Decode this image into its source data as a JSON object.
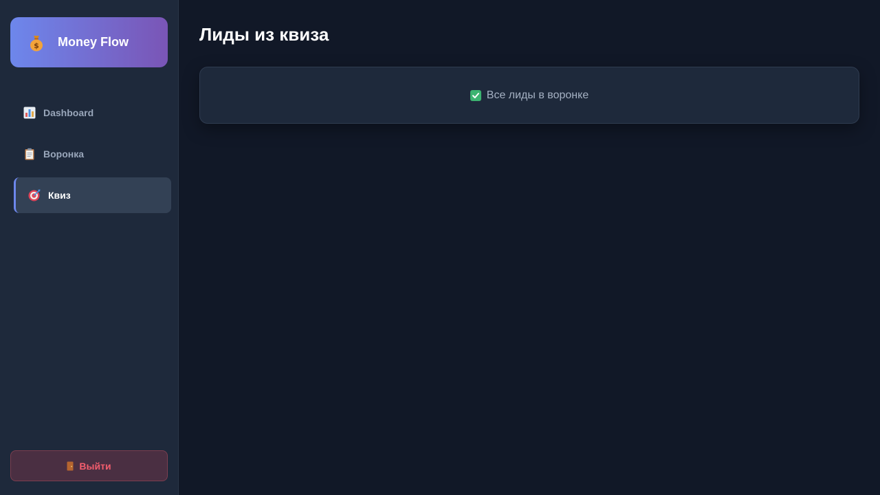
{
  "brand": {
    "title": "Money Flow",
    "icon": "money-bag-icon"
  },
  "sidebar": {
    "items": [
      {
        "label": "Dashboard",
        "icon": "bar-chart-icon",
        "active": false
      },
      {
        "label": "Воронка",
        "icon": "clipboard-icon",
        "active": false
      },
      {
        "label": "Квиз",
        "icon": "target-icon",
        "active": true
      }
    ],
    "logout_label": "Выйти",
    "logout_icon": "door-icon"
  },
  "main": {
    "title": "Лиды из квиза",
    "notice": "Все лиды в воронке",
    "notice_icon": "checkmark-icon"
  },
  "colors": {
    "accent": "#6d87ec",
    "brand_gradient_start": "#6d87ec",
    "brand_gradient_end": "#7a55b6",
    "background": "#111827",
    "sidebar": "#1e293b",
    "danger": "#f25d6d",
    "success": "#3cb371"
  }
}
